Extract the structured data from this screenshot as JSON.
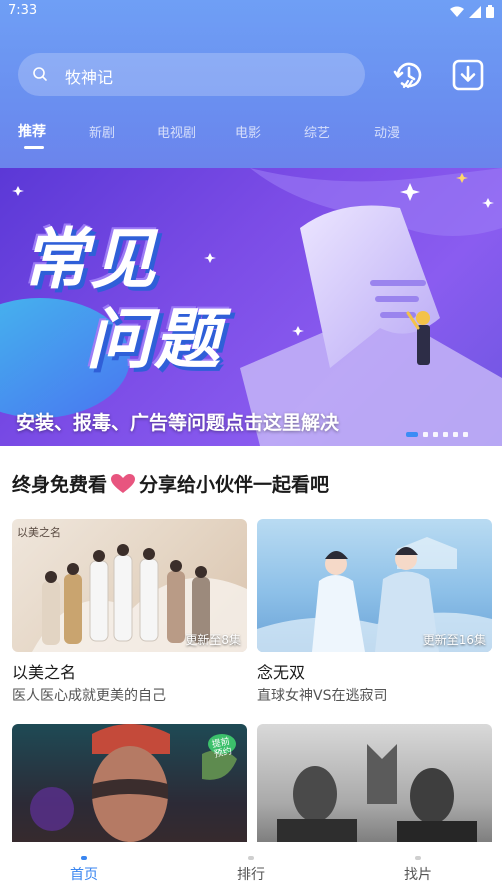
{
  "status_bar": {
    "time": "7:33"
  },
  "search": {
    "value": "牧神记"
  },
  "tabs": [
    {
      "label": "推荐",
      "active": true
    },
    {
      "label": "新剧",
      "active": false
    },
    {
      "label": "电视剧",
      "active": false
    },
    {
      "label": "电影",
      "active": false
    },
    {
      "label": "综艺",
      "active": false
    },
    {
      "label": "动漫",
      "active": false
    }
  ],
  "banner": {
    "title_line1": "常见",
    "title_line2": "问题",
    "caption": "安装、报毒、广告等问题点击这里解决",
    "slide_count": 6,
    "active_slide": 1
  },
  "share_banner": {
    "text_left": "终身免费看",
    "text_right": "分享给小伙伴一起看吧",
    "icon": "heart-icon"
  },
  "cards": [
    {
      "title": "以美之名",
      "subtitle": "医人医心成就更美的自己",
      "badge": "更新至8集",
      "poster_text": "以美之名"
    },
    {
      "title": "念无双",
      "subtitle": "直球女神VS在逃寂司",
      "badge": "更新至16集"
    },
    {
      "title": "",
      "subtitle": "",
      "badge": "",
      "poster_text": "提前预约"
    },
    {
      "title": "",
      "subtitle": "",
      "badge": ""
    }
  ],
  "bottom_nav": [
    {
      "label": "首页",
      "active": true
    },
    {
      "label": "排行",
      "active": false
    },
    {
      "label": "找片",
      "active": false
    }
  ],
  "colors": {
    "accent": "#3a86f0",
    "header_top": "#6f9ff5",
    "header_bottom": "#6b84ec",
    "banner_purple": "#7b4ce6",
    "heart": "#e8557f"
  }
}
